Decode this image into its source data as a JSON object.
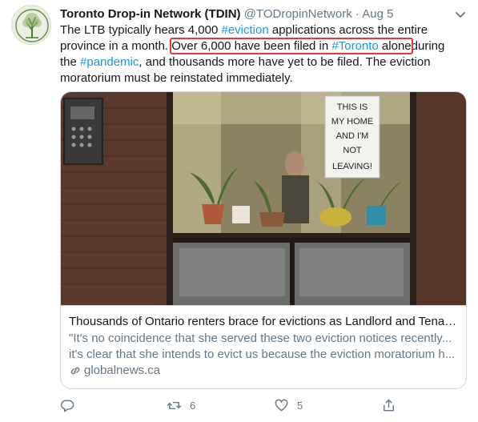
{
  "tweet": {
    "author_name": "Toronto Drop-in Network (TDIN)",
    "handle": "@TODropinNetwork",
    "separator": "·",
    "date": "Aug 5",
    "text": {
      "part1": "The LTB typically hears 4,000 ",
      "tag_eviction": "#eviction",
      "part2": " applications across the entire province in a month. ",
      "hl_part1": "Over 6,000 have been filed in ",
      "tag_toronto": "#Toronto",
      "hl_part2": " alone",
      "part3": "during the ",
      "tag_pandemic": "#pandemic",
      "part4": ", and thousands more have yet to be filed. The eviction moratorium must be reinstated immediately."
    }
  },
  "card": {
    "sign_lines": [
      "THIS IS",
      "MY HOME",
      "AND I'M",
      "NOT",
      "LEAVING!"
    ],
    "title": "Thousands of Ontario renters brace for evictions as Landlord and Tenan...",
    "description_line1": "\"It's no coincidence that she served these two eviction notices recently...",
    "description_line2": "it's clear that she intends to evict us because the eviction moratorium h...",
    "domain": "globalnews.ca"
  },
  "actions": {
    "reply_count": "",
    "retweet_count": "6",
    "like_count": "5",
    "share_count": ""
  },
  "colors": {
    "link": "#1b95e0",
    "secondary_text": "#657786",
    "highlight_box": "#e03a3a",
    "border": "#ccd6dd"
  }
}
